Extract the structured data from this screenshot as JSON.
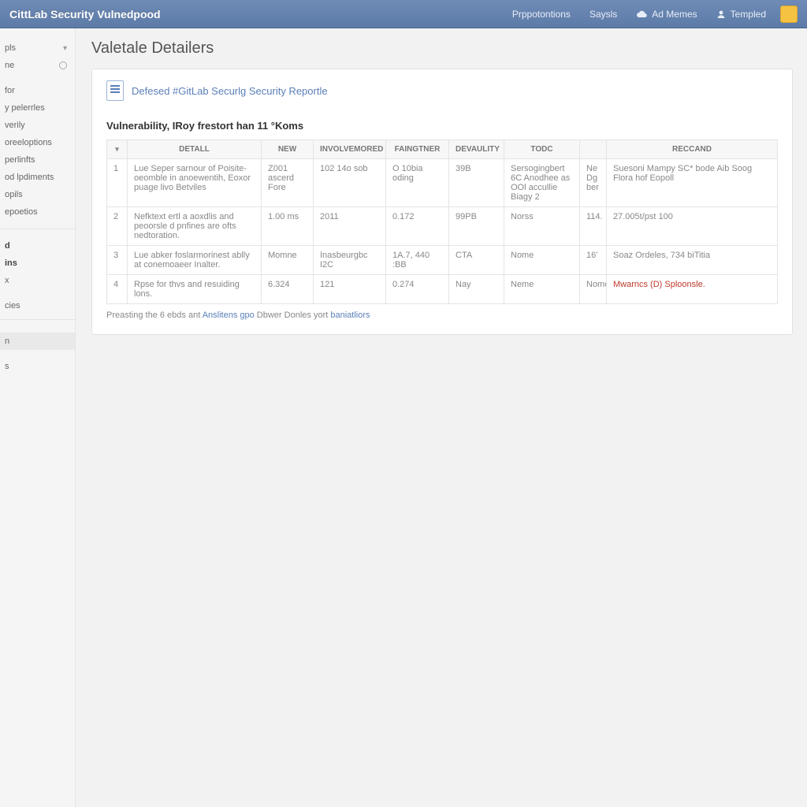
{
  "topbar": {
    "brand": "CittLab Security Vulnedpood",
    "nav": {
      "prepositions": "Prppotontions",
      "saysls": "Saysls",
      "ad_memes": "Ad Memes",
      "templed": "Templed"
    }
  },
  "sidebar": {
    "items": [
      {
        "label": "pls",
        "chevron": true
      },
      {
        "label": "ne",
        "radio": true
      },
      {
        "label": ""
      },
      {
        "label": "for"
      },
      {
        "label": "y pelerrles"
      },
      {
        "label": "verily"
      },
      {
        "label": "oreeloptions"
      },
      {
        "label": "perlinfts"
      },
      {
        "label": "od lpdiments"
      },
      {
        "label": "opils"
      },
      {
        "label": "epoetios"
      }
    ],
    "group2_header_d": "d",
    "group2_header_ins": "ins",
    "group2_items": [
      {
        "label": "x"
      },
      {
        "label": "cies"
      },
      {
        "label": ""
      },
      {
        "label": "n",
        "selected": true
      },
      {
        "label": ""
      },
      {
        "label": "s"
      }
    ]
  },
  "main": {
    "page_title": "Valetale Detailers",
    "doc_link": "Defesed #GitLab Securlg Security Reportle",
    "section_title": "Vulnerability, IRoy frestort han 11 °Koms",
    "columns": {
      "idx": "▾",
      "detall": "Detall",
      "new": "New",
      "involvemored": "Involvemored",
      "faingtner": "Faingtner",
      "devaulity": "Devaulity",
      "todc": "Todc",
      "mid": "",
      "reccand": "Reccand"
    },
    "rows": [
      {
        "idx": "1",
        "detall": "Lue Seper sarnour of Poisite- oeomble in anoewentih, Eoxor puage livo Betviles",
        "new": "Z001 ascerd Fore",
        "involvemored": "102 14o sob",
        "faingtner": "O 10bia oding",
        "devaulity": "39B",
        "todc": "Sersogingbert 6C Anodhee as OOl accullie Biagy 2",
        "mid": "Ne Dg ber",
        "reccand": "Suesoni Mampy SC* bode Aib Soog Flora hof Eopoll"
      },
      {
        "idx": "2",
        "detall": "Nefktext ertl a aoxdlis and peoorsle d pnfines are ofts nedtoration.",
        "new": "1.00 ms",
        "involvemored": "2011",
        "faingtner": "0.172",
        "devaulity": "99PB",
        "todc": "Norss",
        "mid": "114.",
        "reccand": "27.005t/pst 100"
      },
      {
        "idx": "3",
        "detall": "Lue abker foslarmorinest ablly at conemoaeer Inalter.",
        "new": "Momne",
        "involvemored": "Inasbeurgbc I2C",
        "faingtner": "1A.7, 440 :BB",
        "devaulity": "CTA",
        "todc": "Nome",
        "mid": "16'",
        "reccand": "Soaz Ordeles, 734 biTitia"
      },
      {
        "idx": "4",
        "detall": "Rpse for thvs and resuiding lons.",
        "new": "6.324",
        "involvemored": "121",
        "faingtner": "0.274",
        "devaulity": "Nay",
        "todc": "Neme",
        "mid": "Nomor",
        "reccand": "Mwarncs (D) Sploonsle.",
        "reccand_red": true
      }
    ],
    "footer": {
      "prefix": "Preasting the 6 ebds ant ",
      "link1": "Anslitens gpo",
      "middle": " Dbwer Donles yort ",
      "link2": "baniatliors"
    }
  }
}
